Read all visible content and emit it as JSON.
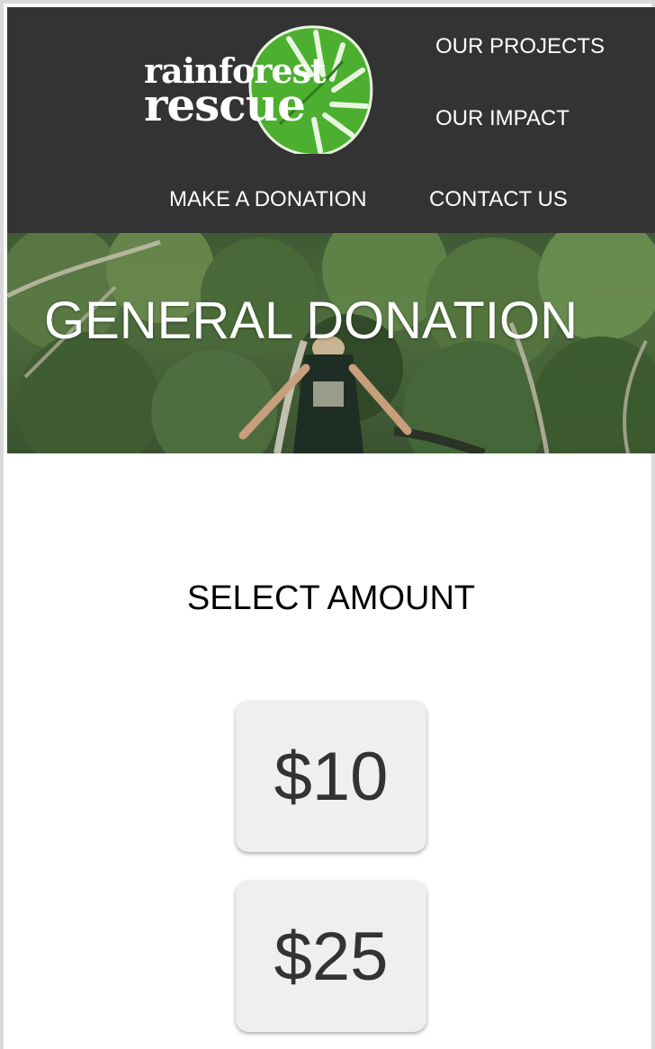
{
  "header": {
    "logo": {
      "line1": "rainforest",
      "line2": "rescue",
      "icon": "monstera-leaf-icon",
      "leaf_color": "#4caf2f"
    },
    "nav": {
      "projects": "OUR PROJECTS",
      "impact": "OUR IMPACT",
      "donate": "MAKE A DONATION",
      "contact": "CONTACT US"
    },
    "background_color": "#333333"
  },
  "hero": {
    "title": "GENERAL DONATION",
    "image": "volunteer-on-canopy-bridge-photo"
  },
  "main": {
    "select_label": "SELECT AMOUNT",
    "amounts": [
      "$10",
      "$25"
    ]
  }
}
